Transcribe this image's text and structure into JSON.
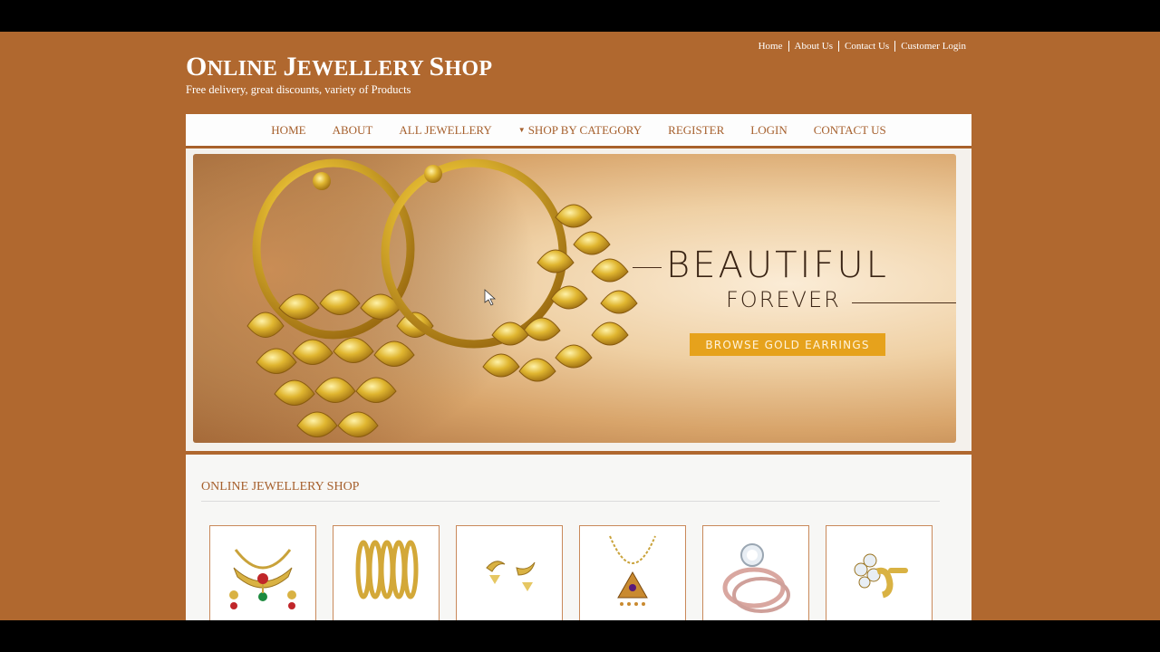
{
  "header": {
    "site_title_first": "O",
    "site_title_rest": "NLINE ",
    "site_title_second": "J",
    "site_title_rest2": "EWELLERY ",
    "site_title_third": "S",
    "site_title_rest3": "HOP",
    "tagline": "Free delivery, great discounts, variety of Products",
    "top_links": [
      "Home",
      "About Us",
      "Contact Us",
      "Customer Login"
    ]
  },
  "nav": {
    "items": [
      "HOME",
      "ABOUT",
      "ALL JEWELLERY",
      "SHOP BY CATEGORY",
      "REGISTER",
      "LOGIN",
      "CONTACT US"
    ]
  },
  "banner": {
    "headline": "BEAUTIFUL",
    "subheadline": "FOREVER",
    "button": "BROWSE GOLD EARRINGS"
  },
  "section": {
    "title": "ONLINE JEWELLERY SHOP",
    "products": [
      {
        "icon": "necklace-set-icon"
      },
      {
        "icon": "bangles-icon"
      },
      {
        "icon": "earrings-icon"
      },
      {
        "icon": "pendant-necklace-icon"
      },
      {
        "icon": "diamond-ring-icon"
      },
      {
        "icon": "nose-pin-icon"
      }
    ]
  },
  "colors": {
    "page_bg": "#b0682f",
    "accent": "#a6602d",
    "button": "#e6a21c"
  }
}
